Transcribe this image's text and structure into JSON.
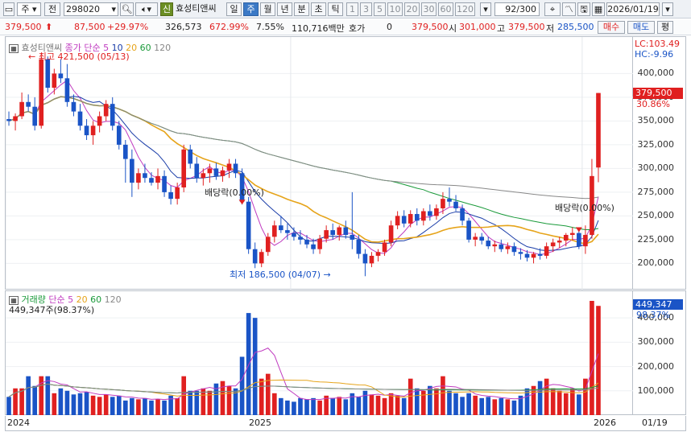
{
  "toolbar": {
    "market": "주",
    "prev": "전",
    "code": "298020",
    "sin": "신",
    "name": "효성티앤씨",
    "periods": [
      "일",
      "주",
      "월",
      "년",
      "분",
      "초",
      "틱"
    ],
    "selected_period": "주",
    "minutes": [
      "1",
      "3",
      "5",
      "10",
      "20",
      "30",
      "60",
      "120"
    ],
    "count": "92/300",
    "date": "2026/01/19"
  },
  "quote": {
    "price": "379,500",
    "change": "87,500",
    "change_pct": "+29.97%",
    "volume": "326,573",
    "vol_ratio": "672.99%",
    "turnover": "7.55%",
    "amount": "110,716백만",
    "hoga_label": "호가",
    "hoga_value": "0",
    "ask": "379,500",
    "open_label": "시",
    "open": "301,000",
    "high_label": "고",
    "high": "379,500",
    "low_label": "저",
    "low": "285,500",
    "buy_label": "매수",
    "sell_label": "매도",
    "eval_label": "평"
  },
  "price_panel": {
    "name": "효성티앤씨",
    "ma_title": "종가 단순",
    "ma_periods": [
      "5",
      "10",
      "20",
      "60",
      "120"
    ],
    "lc": "LC:103.49",
    "hc": "HC:-9.96",
    "high_note": "최고 421,500 (05/13)",
    "low_note": "최저 186,500 (04/07)",
    "div_note1": "배당락(0.00%)",
    "div_note2": "배당락(0.00%)",
    "current_price": "379,500",
    "current_pct": "30.86%",
    "yticks": [
      "400,000",
      "375,000",
      "350,000",
      "325,000",
      "300,000",
      "275,000",
      "250,000",
      "225,000",
      "200,000"
    ]
  },
  "volume_panel": {
    "title": "거래량",
    "ma_title": "단순",
    "ma_periods": [
      "5",
      "20",
      "60",
      "120"
    ],
    "value_label": "449,347주(98.37%)",
    "current_vol": "449,347",
    "current_pct": "98.37%",
    "yticks": [
      "400,000",
      "300,000",
      "200,000",
      "100,000"
    ]
  },
  "xaxis": {
    "labels": [
      "2024",
      "2025",
      "2026"
    ],
    "last_date": "01/19"
  },
  "colors": {
    "up": "#e02020",
    "down": "#1a54c6",
    "ma5": "#c03cc0",
    "ma10": "#1a3da8",
    "ma20": "#e6a41a",
    "ma60": "#1a9a3a",
    "ma120": "#888888"
  },
  "chart_data": {
    "type": "candlestick",
    "ylim": [
      180000,
      430000
    ],
    "candles": [
      [
        352000,
        360000,
        345000,
        350000
      ],
      [
        350000,
        358000,
        340000,
        355000
      ],
      [
        355000,
        380000,
        352000,
        370000
      ],
      [
        370000,
        378000,
        360000,
        365000
      ],
      [
        365000,
        375000,
        340000,
        345000
      ],
      [
        345000,
        421500,
        342000,
        415000
      ],
      [
        415000,
        418000,
        380000,
        385000
      ],
      [
        385000,
        405000,
        378000,
        400000
      ],
      [
        400000,
        415000,
        390000,
        395000
      ],
      [
        395000,
        410000,
        365000,
        370000
      ],
      [
        370000,
        378000,
        355000,
        360000
      ],
      [
        360000,
        368000,
        340000,
        345000
      ],
      [
        345000,
        352000,
        330000,
        335000
      ],
      [
        335000,
        350000,
        325000,
        345000
      ],
      [
        345000,
        360000,
        338000,
        355000
      ],
      [
        355000,
        372000,
        350000,
        368000
      ],
      [
        368000,
        375000,
        340000,
        345000
      ],
      [
        345000,
        350000,
        320000,
        325000
      ],
      [
        325000,
        330000,
        285000,
        310000
      ],
      [
        310000,
        320000,
        270000,
        285000
      ],
      [
        285000,
        300000,
        278000,
        295000
      ],
      [
        295000,
        305000,
        285000,
        290000
      ],
      [
        290000,
        296000,
        282000,
        285000
      ],
      [
        285000,
        300000,
        278000,
        292000
      ],
      [
        292000,
        298000,
        270000,
        275000
      ],
      [
        275000,
        282000,
        262000,
        268000
      ],
      [
        268000,
        285000,
        262000,
        280000
      ],
      [
        280000,
        325000,
        275000,
        320000
      ],
      [
        320000,
        325000,
        300000,
        305000
      ],
      [
        305000,
        312000,
        285000,
        290000
      ],
      [
        290000,
        300000,
        282000,
        295000
      ],
      [
        295000,
        305000,
        285000,
        300000
      ],
      [
        300000,
        306000,
        288000,
        292000
      ],
      [
        292000,
        302000,
        286000,
        298000
      ],
      [
        298000,
        310000,
        290000,
        305000
      ],
      [
        305000,
        310000,
        290000,
        295000
      ],
      [
        295000,
        300000,
        262000,
        265000
      ],
      [
        265000,
        270000,
        210000,
        215000
      ],
      [
        215000,
        222000,
        195000,
        200000
      ],
      [
        200000,
        215000,
        196000,
        212000
      ],
      [
        212000,
        232000,
        208000,
        228000
      ],
      [
        228000,
        245000,
        222000,
        240000
      ],
      [
        240000,
        250000,
        232000,
        235000
      ],
      [
        235000,
        242000,
        225000,
        232000
      ],
      [
        232000,
        238000,
        224000,
        228000
      ],
      [
        228000,
        235000,
        220000,
        225000
      ],
      [
        225000,
        230000,
        216000,
        220000
      ],
      [
        220000,
        226000,
        210000,
        215000
      ],
      [
        215000,
        230000,
        210000,
        226000
      ],
      [
        226000,
        240000,
        222000,
        235000
      ],
      [
        235000,
        242000,
        225000,
        230000
      ],
      [
        230000,
        240000,
        224000,
        238000
      ],
      [
        238000,
        245000,
        226000,
        230000
      ],
      [
        230000,
        275000,
        215000,
        225000
      ],
      [
        225000,
        230000,
        205000,
        210000
      ],
      [
        210000,
        215000,
        186500,
        200000
      ],
      [
        200000,
        212000,
        196000,
        208000
      ],
      [
        208000,
        215000,
        202000,
        212000
      ],
      [
        212000,
        225000,
        208000,
        222000
      ],
      [
        222000,
        245000,
        218000,
        240000
      ],
      [
        240000,
        255000,
        236000,
        250000
      ],
      [
        250000,
        256000,
        238000,
        242000
      ],
      [
        242000,
        256000,
        238000,
        252000
      ],
      [
        252000,
        258000,
        240000,
        245000
      ],
      [
        245000,
        258000,
        240000,
        255000
      ],
      [
        255000,
        262000,
        245000,
        250000
      ],
      [
        250000,
        262000,
        246000,
        258000
      ],
      [
        258000,
        275000,
        252000,
        268000
      ],
      [
        268000,
        280000,
        260000,
        265000
      ],
      [
        265000,
        272000,
        255000,
        258000
      ],
      [
        258000,
        262000,
        240000,
        245000
      ],
      [
        245000,
        248000,
        222000,
        225000
      ],
      [
        225000,
        232000,
        218000,
        228000
      ],
      [
        228000,
        232000,
        220000,
        224000
      ],
      [
        224000,
        228000,
        215000,
        218000
      ],
      [
        218000,
        224000,
        212000,
        220000
      ],
      [
        220000,
        225000,
        212000,
        215000
      ],
      [
        215000,
        222000,
        210000,
        218000
      ],
      [
        218000,
        222000,
        208000,
        212000
      ],
      [
        212000,
        216000,
        204000,
        210000
      ],
      [
        210000,
        214000,
        202000,
        206000
      ],
      [
        206000,
        212000,
        200000,
        210000
      ],
      [
        210000,
        216000,
        204000,
        208000
      ],
      [
        208000,
        222000,
        205000,
        218000
      ],
      [
        218000,
        226000,
        212000,
        222000
      ],
      [
        222000,
        228000,
        216000,
        224000
      ],
      [
        224000,
        232000,
        218000,
        230000
      ],
      [
        230000,
        238000,
        224000,
        232000
      ],
      [
        232000,
        236000,
        215000,
        218000
      ],
      [
        218000,
        240000,
        210000,
        230000
      ],
      [
        230000,
        310000,
        226000,
        292000
      ],
      [
        301000,
        379500,
        285500,
        379500
      ]
    ],
    "volume": {
      "ylim": [
        0,
        470000
      ],
      "values": [
        75000,
        110000,
        110000,
        160000,
        120000,
        160000,
        160000,
        90000,
        110000,
        100000,
        85000,
        90000,
        95000,
        80000,
        75000,
        85000,
        75000,
        80000,
        60000,
        70000,
        65000,
        70000,
        60000,
        65000,
        60000,
        80000,
        70000,
        160000,
        100000,
        100000,
        110000,
        100000,
        130000,
        140000,
        120000,
        110000,
        240000,
        420000,
        400000,
        150000,
        170000,
        90000,
        70000,
        60000,
        55000,
        70000,
        65000,
        70000,
        60000,
        80000,
        70000,
        75000,
        65000,
        90000,
        75000,
        100000,
        85000,
        80000,
        70000,
        90000,
        80000,
        70000,
        150000,
        110000,
        100000,
        120000,
        110000,
        160000,
        100000,
        90000,
        75000,
        90000,
        80000,
        70000,
        75000,
        65000,
        70000,
        65000,
        60000,
        80000,
        110000,
        120000,
        140000,
        150000,
        110000,
        100000,
        90000,
        110000,
        85000,
        150000,
        470000,
        449347
      ]
    }
  }
}
